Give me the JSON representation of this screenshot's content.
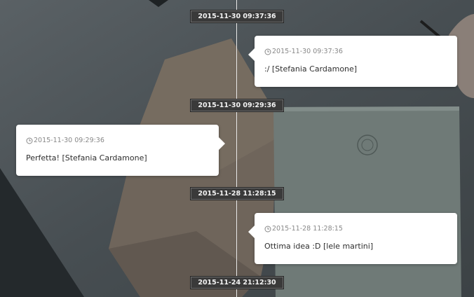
{
  "timeline": {
    "markers": [
      {
        "label": "2015-11-30 09:37:36"
      },
      {
        "label": "2015-11-30 09:29:36"
      },
      {
        "label": "2015-11-28 11:28:15"
      },
      {
        "label": "2015-11-24 21:12:30"
      }
    ],
    "entries": [
      {
        "time": "2015-11-30 09:37:36",
        "message": ":/ [Stefania Cardamone]"
      },
      {
        "time": "2015-11-30 09:29:36",
        "message": "Perfetta!  [Stefania Cardamone]"
      },
      {
        "time": "2015-11-28 11:28:15",
        "message": "Ottima idea :D [lele martini]"
      }
    ]
  },
  "icons": {
    "entry_time": "clock-icon"
  },
  "colors": {
    "card_background": "#ffffff",
    "date_pill_background": "#3a3a3a",
    "timeline_line": "#e8e8e8"
  }
}
